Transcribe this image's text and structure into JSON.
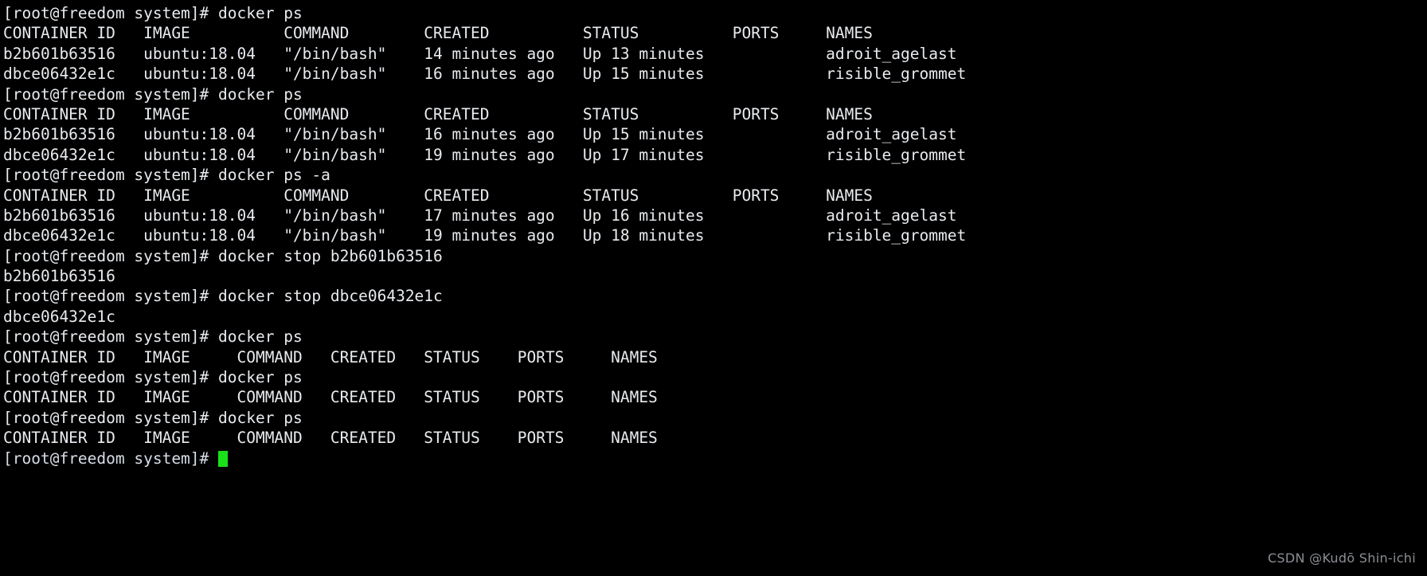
{
  "terminal": {
    "title": "docker ps session",
    "prompt": "[root@freedom system]# ",
    "colors": {
      "background": "#000000",
      "foreground": "#e8ebef",
      "cursor": "#19e119",
      "watermark": "#8b8f94"
    },
    "cursor": {
      "visible": true,
      "shape": "block"
    },
    "lines": [
      "[root@freedom system]# docker ps",
      "CONTAINER ID   IMAGE          COMMAND        CREATED          STATUS          PORTS     NAMES",
      "b2b601b63516   ubuntu:18.04   \"/bin/bash\"    14 minutes ago   Up 13 minutes             adroit_agelast",
      "dbce06432e1c   ubuntu:18.04   \"/bin/bash\"    16 minutes ago   Up 15 minutes             risible_grommet",
      "[root@freedom system]# docker ps",
      "CONTAINER ID   IMAGE          COMMAND        CREATED          STATUS          PORTS     NAMES",
      "b2b601b63516   ubuntu:18.04   \"/bin/bash\"    16 minutes ago   Up 15 minutes             adroit_agelast",
      "dbce06432e1c   ubuntu:18.04   \"/bin/bash\"    19 minutes ago   Up 17 minutes             risible_grommet",
      "[root@freedom system]# docker ps -a",
      "CONTAINER ID   IMAGE          COMMAND        CREATED          STATUS          PORTS     NAMES",
      "b2b601b63516   ubuntu:18.04   \"/bin/bash\"    17 minutes ago   Up 16 minutes             adroit_agelast",
      "dbce06432e1c   ubuntu:18.04   \"/bin/bash\"    19 minutes ago   Up 18 minutes             risible_grommet",
      "[root@freedom system]# docker stop b2b601b63516",
      "b2b601b63516",
      "[root@freedom system]# docker stop dbce06432e1c",
      "dbce06432e1c",
      "[root@freedom system]# docker ps",
      "CONTAINER ID   IMAGE     COMMAND   CREATED   STATUS    PORTS     NAMES",
      "[root@freedom system]# docker ps",
      "CONTAINER ID   IMAGE     COMMAND   CREATED   STATUS    PORTS     NAMES",
      "[root@freedom system]# docker ps",
      "CONTAINER ID   IMAGE     COMMAND   CREATED   STATUS    PORTS     NAMES"
    ],
    "final_prompt": "[root@freedom system]# "
  },
  "watermark": {
    "text": "CSDN @Kudō Shin-ichi"
  }
}
